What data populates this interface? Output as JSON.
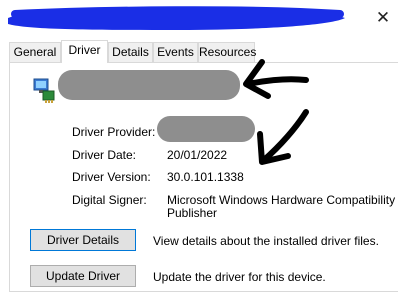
{
  "window": {
    "title_redacted": true,
    "title_bar_color": "#1a2ee6",
    "close_glyph": "✕"
  },
  "tabs": [
    {
      "label": "General",
      "active": false
    },
    {
      "label": "Driver",
      "active": true
    },
    {
      "label": "Details",
      "active": false
    },
    {
      "label": "Events",
      "active": false
    },
    {
      "label": "Resources",
      "active": false
    }
  ],
  "device": {
    "icon": "network-adapter-icon",
    "name_redacted": true
  },
  "properties": {
    "provider_label": "Driver Provider:",
    "date_label": "Driver Date:",
    "date_value": "20/01/2022",
    "version_label": "Driver Version:",
    "version_value": "30.0.101.1338",
    "signer_label": "Digital Signer:",
    "signer_value_line1": "Microsoft Windows Hardware Compatibility",
    "signer_value_line2": "Publisher"
  },
  "actions": {
    "details_button": "Driver Details",
    "details_desc": "View details about the installed driver files.",
    "update_button": "Update Driver",
    "update_desc": "Update the driver for this device."
  },
  "colors": {
    "redaction": "#8e8e8e",
    "annotation_arrow": "#000000",
    "focus_border": "#0078d7"
  }
}
